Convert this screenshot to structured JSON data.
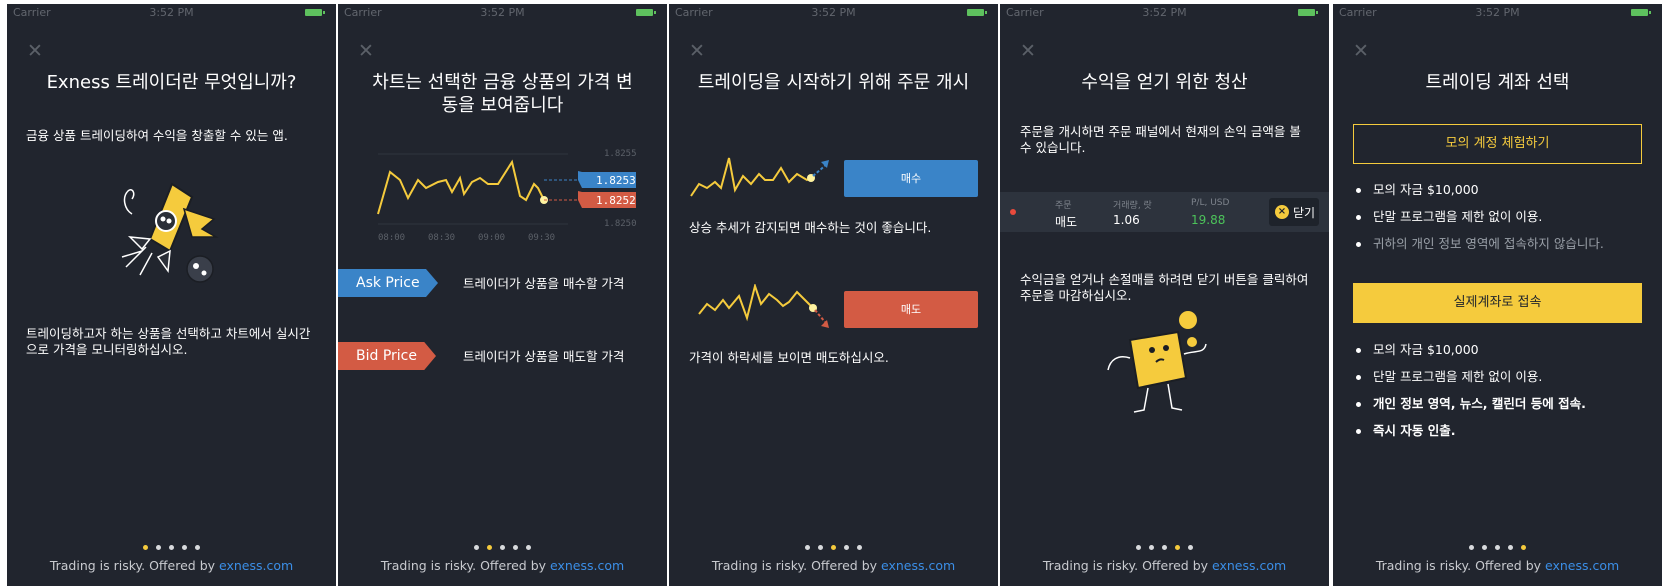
{
  "status_bar": {
    "carrier": "Carrier",
    "time": "3:52 PM"
  },
  "close_glyph": "✕",
  "footer": {
    "text": "Trading is risky. Offered by ",
    "link": "exness.com"
  },
  "colors": {
    "background": "#21252e",
    "accent_yellow": "#f5cb3d",
    "blue": "#3a84c8",
    "red": "#d35b44",
    "link": "#3b8ee6"
  },
  "screens": [
    {
      "title": "Exness 트레이더란 무엇입니까?",
      "text1": "금융 상품 트레이딩하여 수익을 창출할 수 있는 앱.",
      "text2": "트레이딩하고자 하는 상품을 선택하고 차트에서 실시간으로 가격을 모니터링하십시오.",
      "active_dot": 1
    },
    {
      "title": "차트는 선택한 금융 상품의 가격 변동을 보여줍니다",
      "chart": {
        "price_top": "1.8255",
        "ask": "1.8253",
        "bid": "1.8252",
        "price_bottom": "1.8250",
        "times": [
          "08:00",
          "08:30",
          "09:00",
          "09:30"
        ]
      },
      "ask_tag": "Ask Price",
      "ask_desc": "트레이더가 상품을 매수할 가격",
      "bid_tag": "Bid Price",
      "bid_desc": "트레이더가 상품을 매도할 가격",
      "active_dot": 2
    },
    {
      "title": "트레이딩을 시작하기 위해 주문 개시",
      "buy_label": "매수",
      "buy_desc": "상승 추세가 감지되면 매수하는 것이 좋습니다.",
      "sell_label": "매도",
      "sell_desc": "가격이 하락세를 보이면 매도하십시오.",
      "active_dot": 3
    },
    {
      "title": "수익을 얻기 위한 청산",
      "text1": "주문을 개시하면 주문 패널에서 현재의 손익 금액을 볼 수 있습니다.",
      "panel": {
        "col1_header": "주문",
        "col1_value": "매도",
        "col2_header": "거래량, 랏",
        "col2_value": "1.06",
        "col3_header": "P/L, USD",
        "col3_value": "19.88",
        "close_label": "닫기"
      },
      "text2": "수익금을 얻거나 손절매를 하려면 닫기 버튼을 클릭하여 주문을 마감하십시오.",
      "active_dot": 4
    },
    {
      "title": "트레이딩 계좌 선택",
      "demo_button": "모의 계정 체험하기",
      "demo_bullets": [
        "모의 자금 $10,000",
        "단말 프로그램을 제한 없이 이용.",
        "귀하의 개인 정보 영역에 접속하지 않습니다."
      ],
      "real_button": "실제계좌로 접속",
      "real_bullets": [
        "모의 자금 $10,000",
        "단말 프로그램을 제한 없이 이용.",
        "개인 정보 영역, 뉴스, 캘린더 등에 접속.",
        "즉시 자동 인출."
      ],
      "active_dot": 5
    }
  ]
}
